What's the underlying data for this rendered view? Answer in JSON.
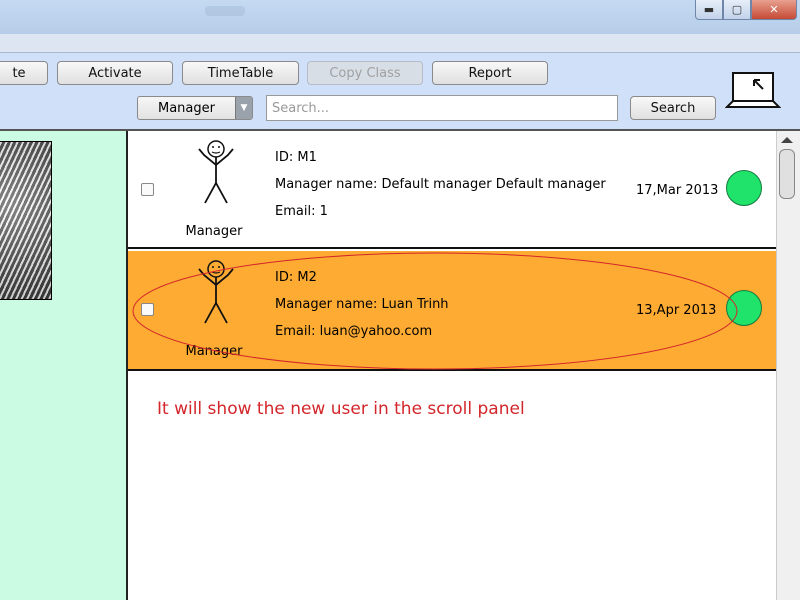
{
  "window": {
    "controls": {
      "minimize": "▬",
      "maximize": "▢",
      "close": "✕"
    }
  },
  "toolbar": {
    "buttons": [
      {
        "name": "partial-button",
        "label": "te"
      },
      {
        "name": "activate-button",
        "label": "Activate"
      },
      {
        "name": "timetable-button",
        "label": "TimeTable"
      },
      {
        "name": "copy-class-button",
        "label": "Copy Class",
        "disabled": true
      },
      {
        "name": "report-button",
        "label": "Report"
      }
    ],
    "role_select": {
      "value": "Manager",
      "arrow": "▼"
    },
    "search": {
      "placeholder": "Search...",
      "button_label": "Search"
    },
    "laptop_icon": "laptop-icon"
  },
  "users": [
    {
      "id_text": "ID: M1",
      "name_text": "Manager name: Default manager Default manager",
      "email_text": "Email: 1",
      "role": "Manager",
      "date": "17,Mar 2013",
      "status_color": "#1fe36b",
      "selected": false
    },
    {
      "id_text": "ID: M2",
      "name_text": "Manager name: Luan Trinh",
      "email_text": "Email: luan@yahoo.com",
      "role": "Manager",
      "date": "13,Apr 2013",
      "status_color": "#1fe36b",
      "selected": true
    }
  ],
  "annotation": "It will show the new user in the scroll panel",
  "colors": {
    "toolbar_bg": "#cfe0f8",
    "left_panel_bg": "#ccfbe4",
    "selected_row_bg": "#fdab33",
    "annotation_color": "#d3262b"
  }
}
